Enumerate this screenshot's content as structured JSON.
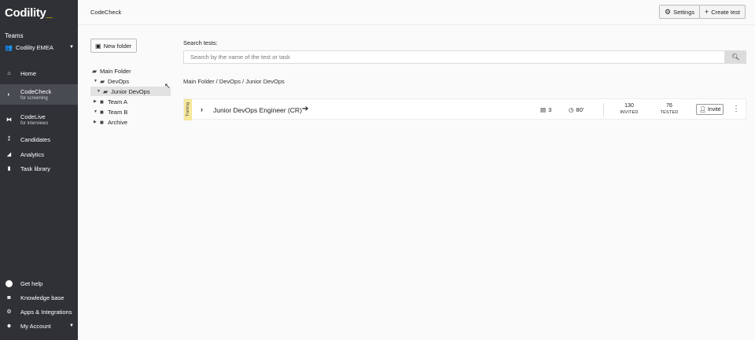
{
  "sidebar": {
    "logo": "Codility",
    "teams_label": "Teams",
    "team_name": "Codility EMEA",
    "nav": [
      {
        "label": "Home",
        "sub": ""
      },
      {
        "label": "CodeCheck",
        "sub": "for screening"
      },
      {
        "label": "CodeLive",
        "sub": "for interviews"
      },
      {
        "label": "Candidates",
        "sub": ""
      },
      {
        "label": "Analytics",
        "sub": ""
      },
      {
        "label": "Task library",
        "sub": ""
      }
    ],
    "bottom": [
      {
        "label": "Get help"
      },
      {
        "label": "Knowledge base"
      },
      {
        "label": "Apps & Integrations"
      },
      {
        "label": "My Account"
      }
    ]
  },
  "header": {
    "title": "CodeCheck",
    "settings_label": "Settings",
    "create_label": "Create test"
  },
  "folders": {
    "new_folder_label": "New folder",
    "items": [
      {
        "label": "Main Folder"
      },
      {
        "label": "DevOps"
      },
      {
        "label": "Junior DevOps"
      },
      {
        "label": "Team A"
      },
      {
        "label": "Team B"
      },
      {
        "label": "Archive"
      }
    ]
  },
  "search": {
    "label": "Search tests:",
    "placeholder": "Search by the name of the test or task"
  },
  "breadcrumb": "Main Folder / DevOps / Junior DevOps",
  "tests": [
    {
      "tag": "Training",
      "title": "Junior DevOps Engineer (CR)",
      "tasks": "3",
      "time": "80'",
      "invited_count": "130",
      "invited_label": "INVITED",
      "tested_count": "76",
      "tested_label": "TESTED",
      "invite_label": "Invite"
    }
  ]
}
